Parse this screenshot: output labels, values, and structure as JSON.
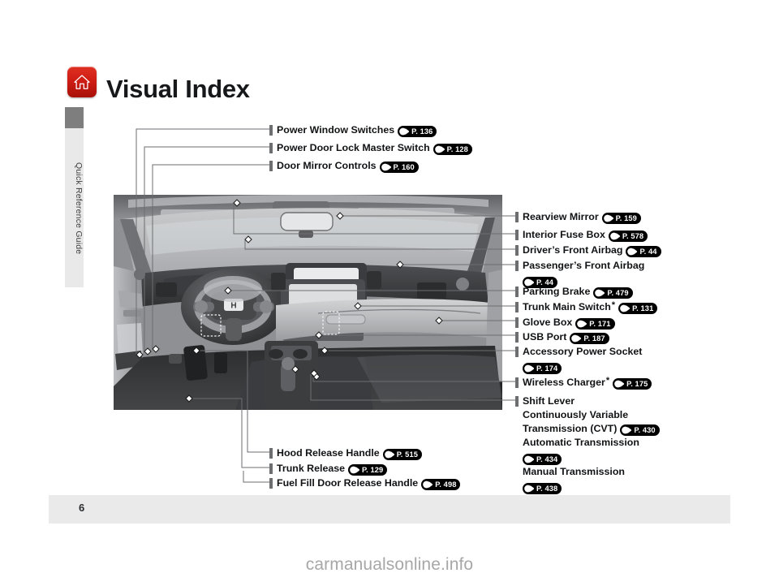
{
  "page": {
    "title": "Visual Index",
    "folio": "6",
    "watermark": "carmanualsonline.info",
    "home_icon": "home-icon"
  },
  "sidebar": {
    "tab_label": "Quick Reference Guide"
  },
  "callouts": {
    "top_left": [
      {
        "label": "Power Window Switches",
        "page_ref": "P. 136",
        "asterisk": false
      },
      {
        "label": "Power Door Lock Master Switch",
        "page_ref": "P. 128",
        "asterisk": false
      },
      {
        "label": "Door Mirror Controls",
        "page_ref": "P. 160",
        "asterisk": false
      }
    ],
    "right": [
      {
        "label": "Rearview Mirror",
        "page_ref": "P. 159",
        "asterisk": false
      },
      {
        "label": "Interior Fuse Box",
        "page_ref": "P. 578",
        "asterisk": false
      },
      {
        "label": "Driver’s Front Airbag",
        "page_ref": "P. 44",
        "asterisk": false
      },
      {
        "label": "Passenger’s Front Airbag",
        "page_ref": "P. 44",
        "asterisk": false,
        "wrap": true
      },
      {
        "label": "Parking Brake",
        "page_ref": "P. 479",
        "asterisk": false
      },
      {
        "label": "Trunk Main Switch",
        "page_ref": "P. 131",
        "asterisk": true
      },
      {
        "label": "Glove Box",
        "page_ref": "P. 171",
        "asterisk": false
      },
      {
        "label": "USB Port",
        "page_ref": "P. 187",
        "asterisk": false
      },
      {
        "label": "Accessory Power Socket",
        "page_ref": "P. 174",
        "asterisk": false,
        "wrap": true
      },
      {
        "label": "Wireless Charger",
        "page_ref": "P. 175",
        "asterisk": true
      }
    ],
    "shift_lever": {
      "label": "Shift Lever",
      "variants": [
        {
          "name_line1": "Continuously Variable",
          "name_line2": "Transmission (CVT)",
          "page_ref": "P. 430",
          "inline_ref": true
        },
        {
          "name_line1": "Automatic Transmission",
          "name_line2": "",
          "page_ref": "P. 434",
          "inline_ref": false
        },
        {
          "name_line1": "Manual Transmission",
          "name_line2": "",
          "page_ref": "P. 438",
          "inline_ref": false
        }
      ]
    },
    "bottom": [
      {
        "label": "Hood Release Handle",
        "page_ref": "P. 515",
        "asterisk": false
      },
      {
        "label": "Trunk Release",
        "page_ref": "P. 129",
        "asterisk": false
      },
      {
        "label": "Fuel Fill Door Release Handle",
        "page_ref": "P. 498",
        "asterisk": false
      }
    ]
  },
  "colors": {
    "home_button_red": "#cf1d14",
    "side_tab_cap": "#7e7e7e",
    "side_tab_body": "#e9e9e9",
    "footer_bar": "#eaeaea",
    "tick_gray": "#6d6e70",
    "pill_black": "#000000",
    "watermark_gray": "#a7a7a7"
  }
}
